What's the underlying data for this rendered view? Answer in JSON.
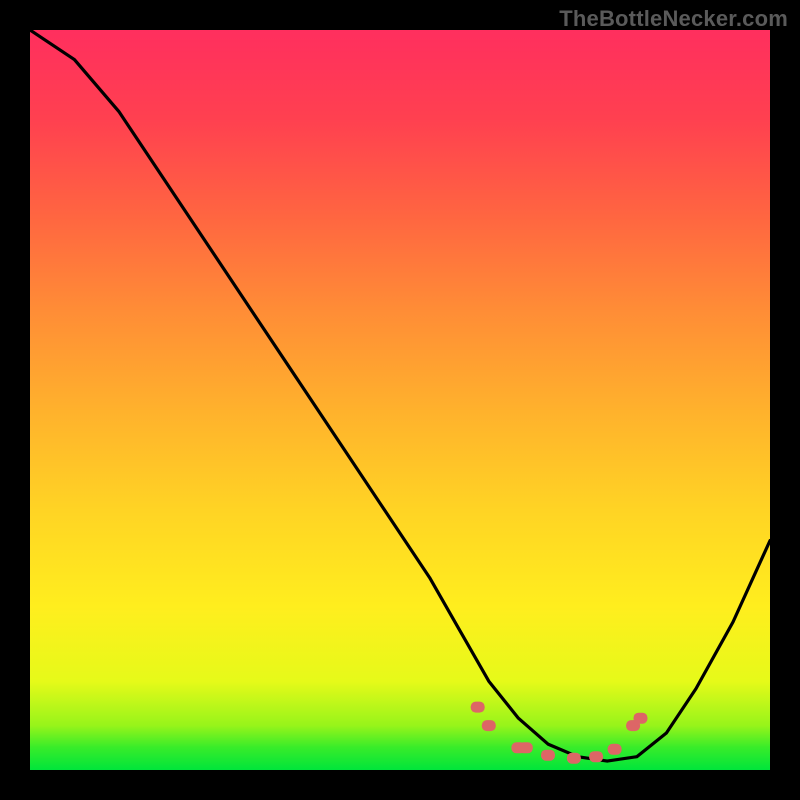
{
  "watermark": "TheBottleNecker.com",
  "chart_data": {
    "type": "line",
    "title": "",
    "xlabel": "",
    "ylabel": "",
    "xlim": [
      0,
      1
    ],
    "ylim": [
      0,
      1
    ],
    "grid": false,
    "legend": false,
    "background": "vertical-rainbow-gradient (green bottom → red/pink top)",
    "series": [
      {
        "name": "curve",
        "color": "#000000",
        "x": [
          0.0,
          0.06,
          0.12,
          0.18,
          0.24,
          0.3,
          0.36,
          0.42,
          0.48,
          0.54,
          0.58,
          0.62,
          0.66,
          0.7,
          0.74,
          0.78,
          0.82,
          0.86,
          0.9,
          0.95,
          1.0
        ],
        "y": [
          1.0,
          0.96,
          0.89,
          0.8,
          0.71,
          0.62,
          0.53,
          0.44,
          0.35,
          0.26,
          0.19,
          0.12,
          0.07,
          0.035,
          0.018,
          0.012,
          0.018,
          0.05,
          0.11,
          0.2,
          0.31
        ]
      },
      {
        "name": "marker-cluster",
        "color": "#dd6666",
        "marker": "rounded-rect",
        "points": [
          {
            "x": 0.605,
            "y": 0.085
          },
          {
            "x": 0.62,
            "y": 0.06
          },
          {
            "x": 0.66,
            "y": 0.03
          },
          {
            "x": 0.67,
            "y": 0.03
          },
          {
            "x": 0.7,
            "y": 0.02
          },
          {
            "x": 0.735,
            "y": 0.016
          },
          {
            "x": 0.765,
            "y": 0.018
          },
          {
            "x": 0.79,
            "y": 0.028
          },
          {
            "x": 0.815,
            "y": 0.06
          },
          {
            "x": 0.825,
            "y": 0.07
          }
        ]
      }
    ]
  }
}
